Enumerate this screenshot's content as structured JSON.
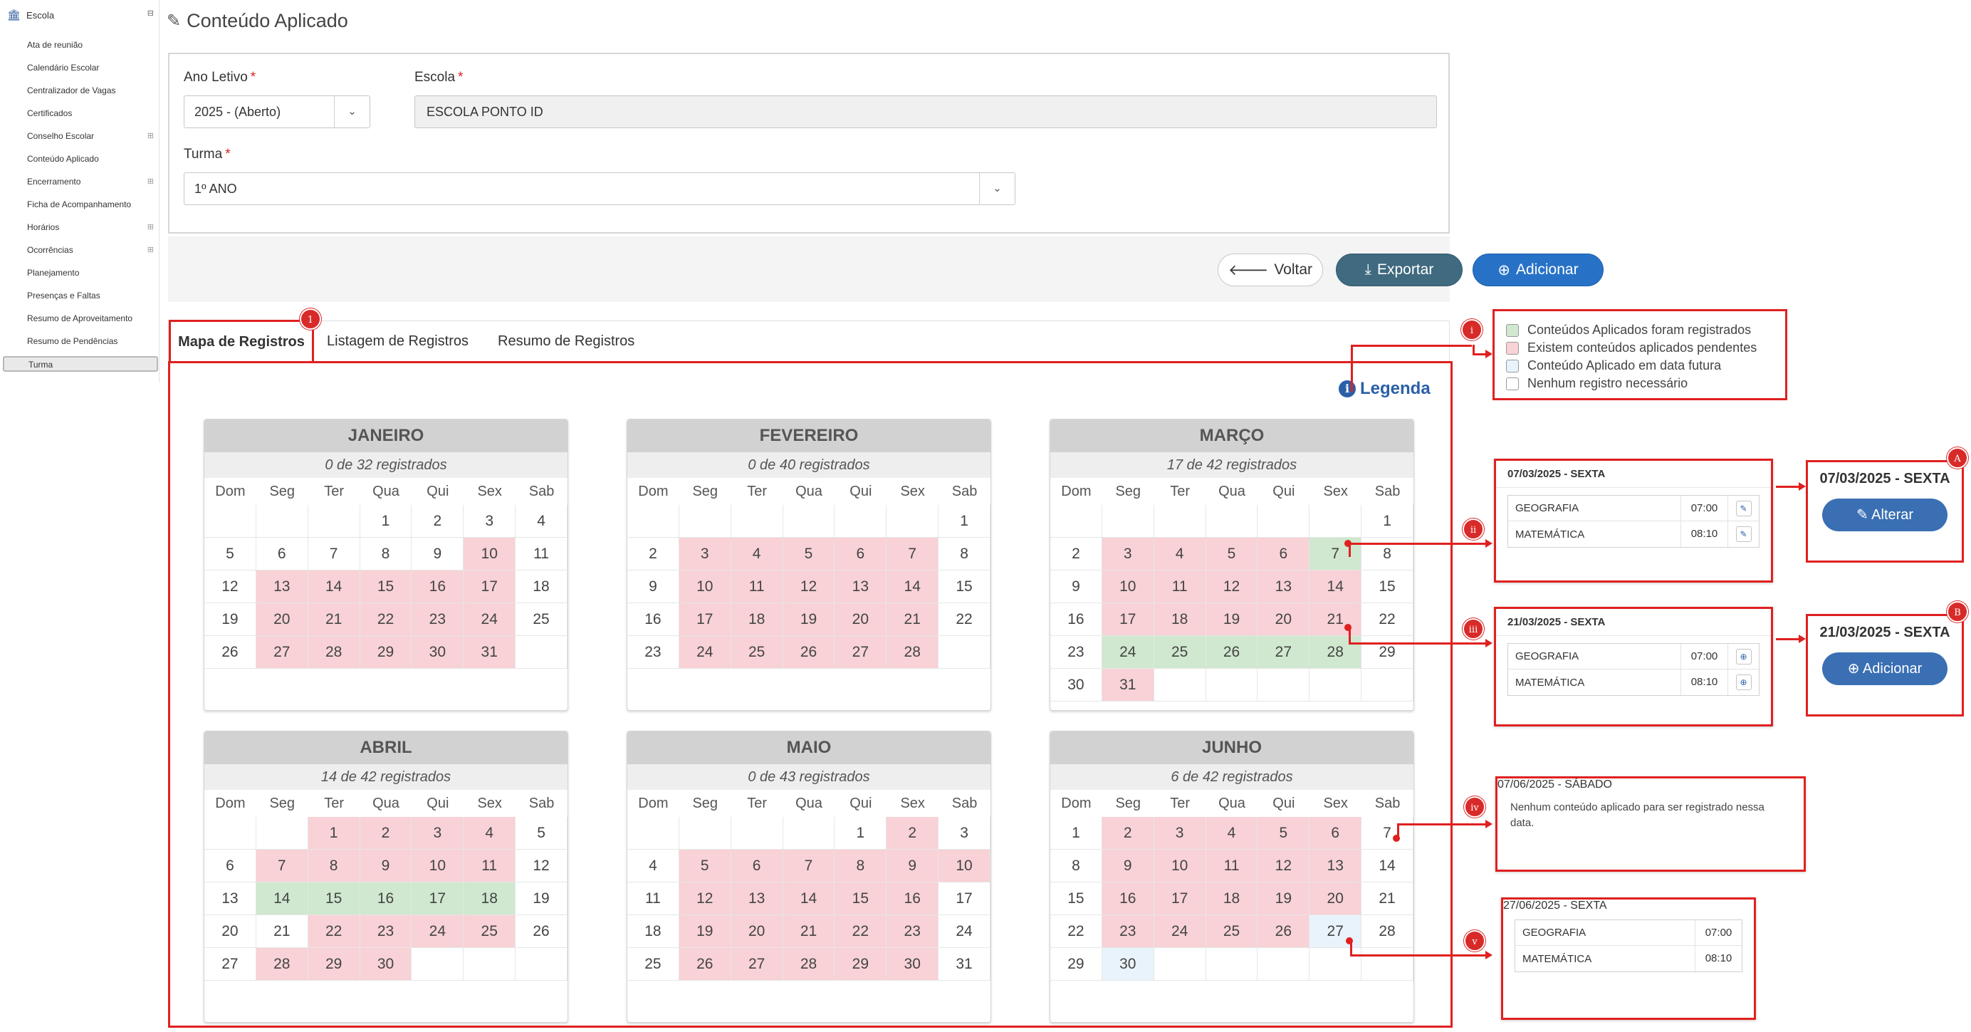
{
  "sidebar": {
    "section": "Escola",
    "section_toggle": "⊟",
    "items": [
      {
        "label": "Ata de reunião",
        "toggle": ""
      },
      {
        "label": "Calendário Escolar",
        "toggle": ""
      },
      {
        "label": "Centralizador de Vagas",
        "toggle": ""
      },
      {
        "label": "Certificados",
        "toggle": ""
      },
      {
        "label": "Conselho Escolar",
        "toggle": "⊞"
      },
      {
        "label": "Conteúdo Aplicado",
        "toggle": ""
      },
      {
        "label": "Encerramento",
        "toggle": "⊞"
      },
      {
        "label": "Ficha de Acompanhamento",
        "toggle": ""
      },
      {
        "label": "Horários",
        "toggle": "⊞"
      },
      {
        "label": "Ocorrências",
        "toggle": "⊞"
      },
      {
        "label": "Planejamento",
        "toggle": ""
      },
      {
        "label": "Presenças e Faltas",
        "toggle": ""
      },
      {
        "label": "Resumo de Aproveitamento",
        "toggle": ""
      },
      {
        "label": "Resumo de Pendências",
        "toggle": ""
      },
      {
        "label": "Turma",
        "toggle": "",
        "active": true
      }
    ]
  },
  "page": {
    "title": "Conteúdo Aplicado"
  },
  "filters": {
    "ano_label": "Ano Letivo",
    "ano_value": "2025 - (Aberto)",
    "escola_label": "Escola",
    "escola_value": "ESCOLA PONTO ID",
    "turma_label": "Turma",
    "turma_value": "1º ANO",
    "required_mark": "*"
  },
  "buttons": {
    "voltar": "Voltar",
    "exportar": "Exportar",
    "adicionar": "Adicionar"
  },
  "tabs": [
    "Mapa de Registros",
    "Listagem de Registros",
    "Resumo de Registros"
  ],
  "legend_link": "Legenda",
  "weekdays": [
    "Dom",
    "Seg",
    "Ter",
    "Qua",
    "Qui",
    "Sex",
    "Sab"
  ],
  "months": [
    {
      "name": "JANEIRO",
      "count": "0 de 32 registrados",
      "start": 3,
      "days": 31,
      "pending": [
        10,
        13,
        14,
        15,
        16,
        17,
        20,
        21,
        22,
        23,
        24,
        27,
        28,
        29,
        30,
        31
      ],
      "registered": [],
      "future": []
    },
    {
      "name": "FEVEREIRO",
      "count": "0 de 40 registrados",
      "start": 6,
      "days": 28,
      "pending": [
        3,
        4,
        5,
        6,
        7,
        10,
        11,
        12,
        13,
        14,
        17,
        18,
        19,
        20,
        21,
        24,
        25,
        26,
        27,
        28
      ],
      "registered": [],
      "future": []
    },
    {
      "name": "MARÇO",
      "count": "17 de 42 registrados",
      "start": 6,
      "days": 31,
      "pending": [
        3,
        4,
        5,
        6,
        10,
        11,
        12,
        13,
        14,
        17,
        18,
        19,
        20,
        21,
        31
      ],
      "registered": [
        7,
        24,
        25,
        26,
        27,
        28
      ],
      "future": []
    },
    {
      "name": "ABRIL",
      "count": "14 de 42 registrados",
      "start": 2,
      "days": 30,
      "pending": [
        1,
        2,
        3,
        4,
        7,
        8,
        9,
        10,
        11,
        22,
        23,
        24,
        25,
        28,
        29,
        30
      ],
      "registered": [
        14,
        15,
        16,
        17,
        18
      ],
      "future": []
    },
    {
      "name": "MAIO",
      "count": "0 de 43 registrados",
      "start": 4,
      "days": 31,
      "pending": [
        2,
        5,
        6,
        7,
        8,
        9,
        10,
        12,
        13,
        14,
        15,
        16,
        19,
        20,
        21,
        22,
        23,
        26,
        27,
        28,
        29,
        30
      ],
      "registered": [],
      "future": []
    },
    {
      "name": "JUNHO",
      "count": "6 de 42 registrados",
      "start": 0,
      "days": 30,
      "pending": [
        2,
        3,
        4,
        5,
        6,
        9,
        10,
        11,
        12,
        13,
        16,
        17,
        18,
        19,
        20,
        23,
        24,
        25,
        26
      ],
      "registered": [],
      "future": [
        27,
        30
      ]
    }
  ],
  "legend": [
    {
      "label": "Conteúdos Aplicados foram registrados",
      "color": "#cfe8cf"
    },
    {
      "label": "Existem conteúdos aplicados pendentes",
      "color": "#f8d2d6"
    },
    {
      "label": "Conteúdo Aplicado em data futura",
      "color": "#e9f3fb"
    },
    {
      "label": "Nenhum registro necessário",
      "color": "#ffffff"
    }
  ],
  "popups": {
    "p2": {
      "title": "07/03/2025 - SEXTA",
      "rows": [
        {
          "subject": "GEOGRAFIA",
          "time": "07:00"
        },
        {
          "subject": "MATEMÁTICA",
          "time": "08:10"
        }
      ]
    },
    "pA": {
      "title": "07/03/2025 - SEXTA",
      "button": "Alterar"
    },
    "p3": {
      "title": "21/03/2025 - SEXTA",
      "rows": [
        {
          "subject": "GEOGRAFIA",
          "time": "07:00"
        },
        {
          "subject": "MATEMÁTICA",
          "time": "08:10"
        }
      ]
    },
    "pB": {
      "title": "21/03/2025 - SEXTA",
      "button": "Adicionar"
    },
    "p4": {
      "title": "07/06/2025 - SÁBADO",
      "text": "Nenhum conteúdo aplicado para ser registrado nessa data."
    },
    "p5": {
      "title": "27/06/2025 - SEXTA",
      "rows": [
        {
          "subject": "GEOGRAFIA",
          "time": "07:00"
        },
        {
          "subject": "MATEMÁTICA",
          "time": "08:10"
        }
      ]
    }
  },
  "badges": {
    "tab": "1",
    "legend": "i",
    "ii": "ii",
    "iii": "iii",
    "iv": "iv",
    "v": "v",
    "A": "A",
    "B": "B"
  },
  "colors": {
    "accent": "#e02020",
    "pending": "#f8d2d6",
    "registered": "#cfe8cf",
    "future": "#e9f3fb",
    "primary": "#2772c7"
  }
}
